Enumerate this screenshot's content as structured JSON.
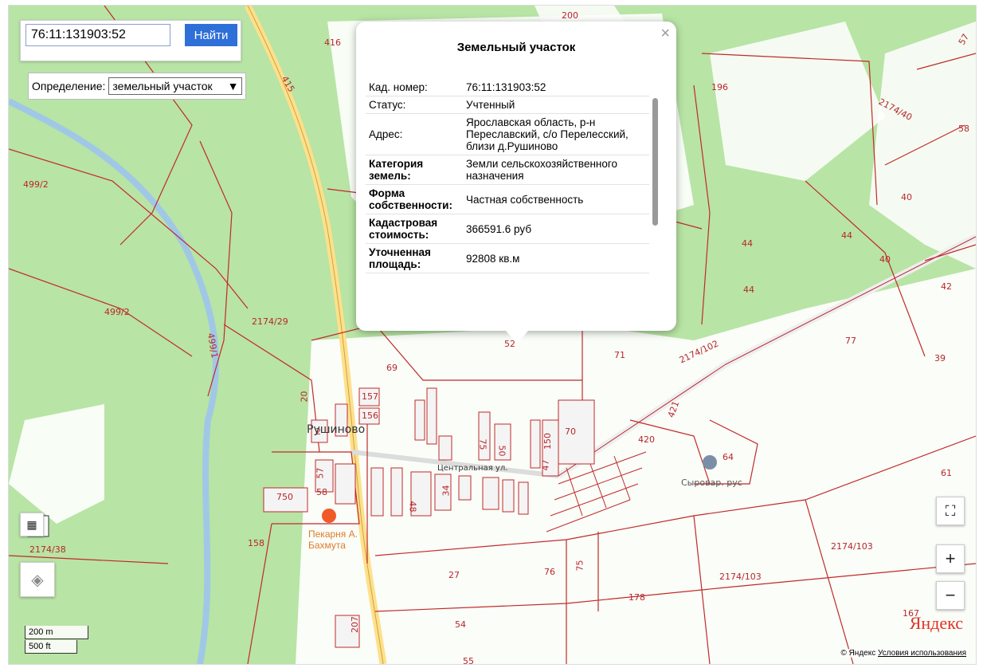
{
  "search": {
    "value": "76:11:131903:52",
    "button": "Найти"
  },
  "definition": {
    "label": "Определение:",
    "value": "земельный участок",
    "arrow": "▼"
  },
  "popup": {
    "title": "Земельный участок",
    "close": "×",
    "rows": [
      {
        "k": "Кад. номер:",
        "v": "76:11:131903:52"
      },
      {
        "k": "Статус:",
        "v": "Учтенный"
      },
      {
        "k": "Адрес:",
        "v": "Ярославская область, р-н Переславский, с/о Перелесский, близи д.Рушиново"
      },
      {
        "k": "Категория земель:",
        "v": "Земли сельскохозяйственного назначения"
      },
      {
        "k": "Форма собственности:",
        "v": "Частная собственность"
      },
      {
        "k": "Кадастровая стоимость:",
        "v": "366591.6 руб"
      },
      {
        "k": "Уточненная площадь:",
        "v": "92808 кв.м"
      }
    ]
  },
  "map_labels": [
    "416",
    "415",
    "200",
    "196",
    "57",
    "2174/40",
    "58",
    "499/2",
    "499/2",
    "40",
    "44",
    "44",
    "44",
    "40",
    "42",
    "2174/29",
    "499/1",
    "77",
    "39",
    "52",
    "71",
    "2174/102",
    "69",
    "20",
    "157",
    "156",
    "2",
    "Рушиново",
    "421",
    "70",
    "420",
    "64",
    "75",
    "50",
    "47",
    "150",
    "Центральная ул.",
    "Сыровар. рус",
    "61",
    "57",
    "58",
    "750",
    "48",
    "34",
    "158",
    "2174/38",
    "2174/103",
    "2174/103",
    "27",
    "76",
    "75",
    "178",
    "54",
    "167",
    "207",
    "55"
  ],
  "poi": {
    "bakery": "Пекарня А. Бахмута"
  },
  "controls": {
    "zoom_in": "+",
    "zoom_out": "−",
    "fullscreen": "⛶"
  },
  "scale": {
    "metric": "200 m",
    "imperial": "500 ft"
  },
  "brand": "Яндекс",
  "copyright": {
    "owner": "© Яндекс",
    "terms": "Условия использования"
  }
}
